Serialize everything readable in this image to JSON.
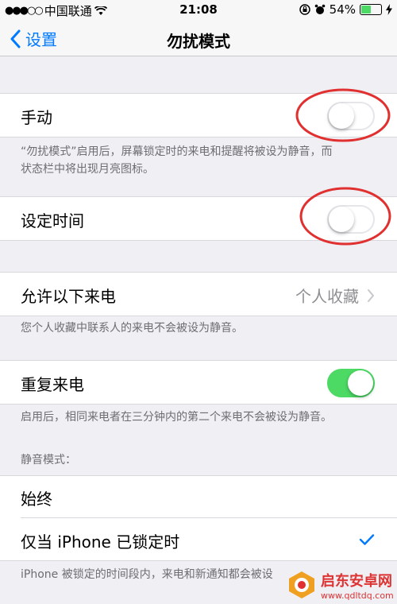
{
  "status_bar": {
    "carrier": "中国联通",
    "time": "21:08",
    "battery_percent": "54%",
    "battery_level": 0.54
  },
  "nav": {
    "back_label": "设置",
    "title": "勿扰模式"
  },
  "manual": {
    "label": "手动",
    "on": false,
    "note_line1": "“勿扰模式”启用后，屏幕锁定时的来电和提醒将被设为静音，而",
    "note_line2": "状态栏中将出现月亮图标。"
  },
  "scheduled": {
    "label": "设定时间",
    "on": false
  },
  "allow_calls": {
    "label": "允许以下来电",
    "value": "个人收藏",
    "note": "您个人收藏中联系人的来电不会被设为静音。"
  },
  "repeated_calls": {
    "label": "重复来电",
    "on": true,
    "note": "启用后，相同来电者在三分钟内的第二个来电不会被设为静音。"
  },
  "silence": {
    "header": "静音模式：",
    "always_label": "始终",
    "locked_label": "仅当 iPhone 已锁定时",
    "locked_selected": true,
    "note": "iPhone 被锁定的时间段内，来电和新通知都会被设"
  },
  "watermark": {
    "name": "启东安卓网",
    "url": "www.qdltdq.com"
  },
  "colors": {
    "accent": "#007aff",
    "toggle_on": "#4cd964",
    "annotation": "#e03030"
  }
}
